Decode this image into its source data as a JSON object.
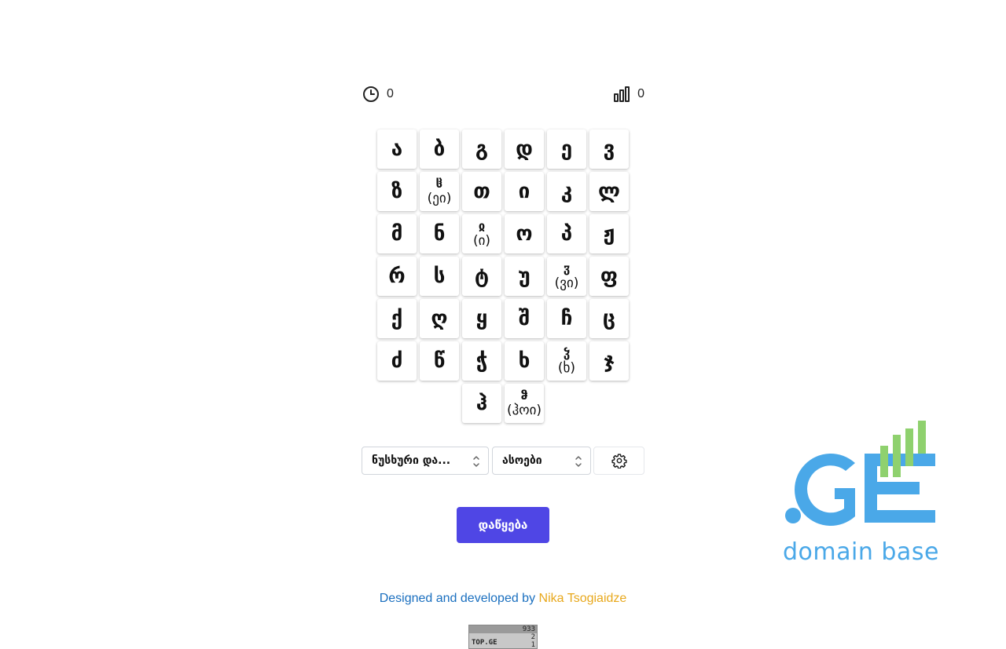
{
  "stats": {
    "timer_value": "0",
    "score_value": "0"
  },
  "letters": [
    [
      {
        "glyph": "ა"
      },
      {
        "glyph": "ბ"
      },
      {
        "glyph": "გ"
      },
      {
        "glyph": "დ"
      },
      {
        "glyph": "ე"
      },
      {
        "glyph": "ვ"
      }
    ],
    [
      {
        "glyph": "ზ"
      },
      {
        "glyph": "ჱ",
        "alt": "(ეი)"
      },
      {
        "glyph": "თ"
      },
      {
        "glyph": "ი"
      },
      {
        "glyph": "კ"
      },
      {
        "glyph": "ლ"
      }
    ],
    [
      {
        "glyph": "მ"
      },
      {
        "glyph": "ნ"
      },
      {
        "glyph": "ჲ",
        "alt": "(ი)"
      },
      {
        "glyph": "ო"
      },
      {
        "glyph": "პ"
      },
      {
        "glyph": "ჟ"
      }
    ],
    [
      {
        "glyph": "რ"
      },
      {
        "glyph": "ს"
      },
      {
        "glyph": "ტ"
      },
      {
        "glyph": "უ"
      },
      {
        "glyph": "ჳ",
        "alt": "(ვი)"
      },
      {
        "glyph": "ფ"
      }
    ],
    [
      {
        "glyph": "ქ"
      },
      {
        "glyph": "ღ"
      },
      {
        "glyph": "ყ"
      },
      {
        "glyph": "შ"
      },
      {
        "glyph": "ჩ"
      },
      {
        "glyph": "ც"
      }
    ],
    [
      {
        "glyph": "ძ"
      },
      {
        "glyph": "წ"
      },
      {
        "glyph": "ჭ"
      },
      {
        "glyph": "ხ"
      },
      {
        "glyph": "ჴ",
        "alt": "(ხ)"
      },
      {
        "glyph": "ჯ"
      }
    ],
    [
      {
        "glyph": "ჰ"
      },
      {
        "glyph": "ჵ",
        "alt": "(ჰოი)"
      }
    ]
  ],
  "controls": {
    "alphabet_select": "ნუსხური და...",
    "mode_select": "ასოები",
    "settings_icon": "gear-icon"
  },
  "start_button": "დაწყება",
  "footer": {
    "credit_prefix": "Designed and developed by",
    "credit_author": "Nika Tsogiaidze",
    "counter_brand": "TOP.GE",
    "counter_values": [
      "933",
      "2",
      "1"
    ]
  },
  "logo": {
    "tagline": "domain base"
  },
  "colors": {
    "accent": "#4f46e5",
    "credit_link": "#1a6fbf",
    "author": "#e8a81c",
    "logo_blue": "#4aa8e8",
    "logo_green": "#8fd16e"
  }
}
